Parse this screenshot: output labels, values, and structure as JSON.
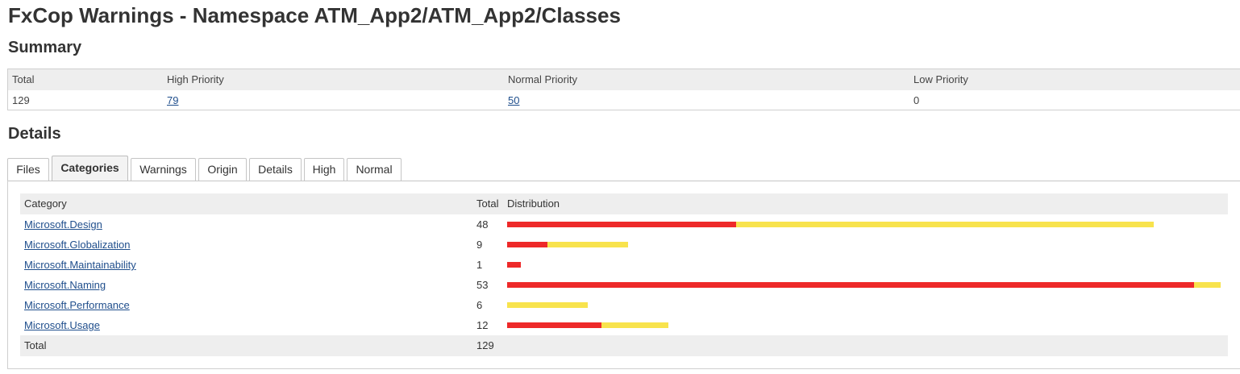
{
  "title": "FxCop Warnings - Namespace ATM_App2/ATM_App2/Classes",
  "summary": {
    "heading": "Summary",
    "columns": [
      "Total",
      "High Priority",
      "Normal Priority",
      "Low Priority"
    ],
    "values": {
      "total": "129",
      "high": "79",
      "normal": "50",
      "low": "0"
    }
  },
  "details": {
    "heading": "Details",
    "tabs": [
      {
        "label": "Files",
        "active": false
      },
      {
        "label": "Categories",
        "active": true
      },
      {
        "label": "Warnings",
        "active": false
      },
      {
        "label": "Origin",
        "active": false
      },
      {
        "label": "Details",
        "active": false
      },
      {
        "label": "High",
        "active": false
      },
      {
        "label": "Normal",
        "active": false
      }
    ],
    "table": {
      "columns": [
        "Category",
        "Total",
        "Distribution"
      ],
      "max_total": 53,
      "rows": [
        {
          "category": "Microsoft.Design",
          "total": "48",
          "high": 17,
          "normal": 31
        },
        {
          "category": "Microsoft.Globalization",
          "total": "9",
          "high": 3,
          "normal": 6
        },
        {
          "category": "Microsoft.Maintainability",
          "total": "1",
          "high": 1,
          "normal": 0
        },
        {
          "category": "Microsoft.Naming",
          "total": "53",
          "high": 51,
          "normal": 2
        },
        {
          "category": "Microsoft.Performance",
          "total": "6",
          "high": 0,
          "normal": 6
        },
        {
          "category": "Microsoft.Usage",
          "total": "12",
          "high": 7,
          "normal": 5
        }
      ],
      "footer": {
        "label": "Total",
        "total": "129"
      }
    }
  },
  "colors": {
    "high": "#ee2929",
    "normal": "#f8e34d",
    "link": "#1f4e8c",
    "header_bg": "#eeeeee"
  }
}
